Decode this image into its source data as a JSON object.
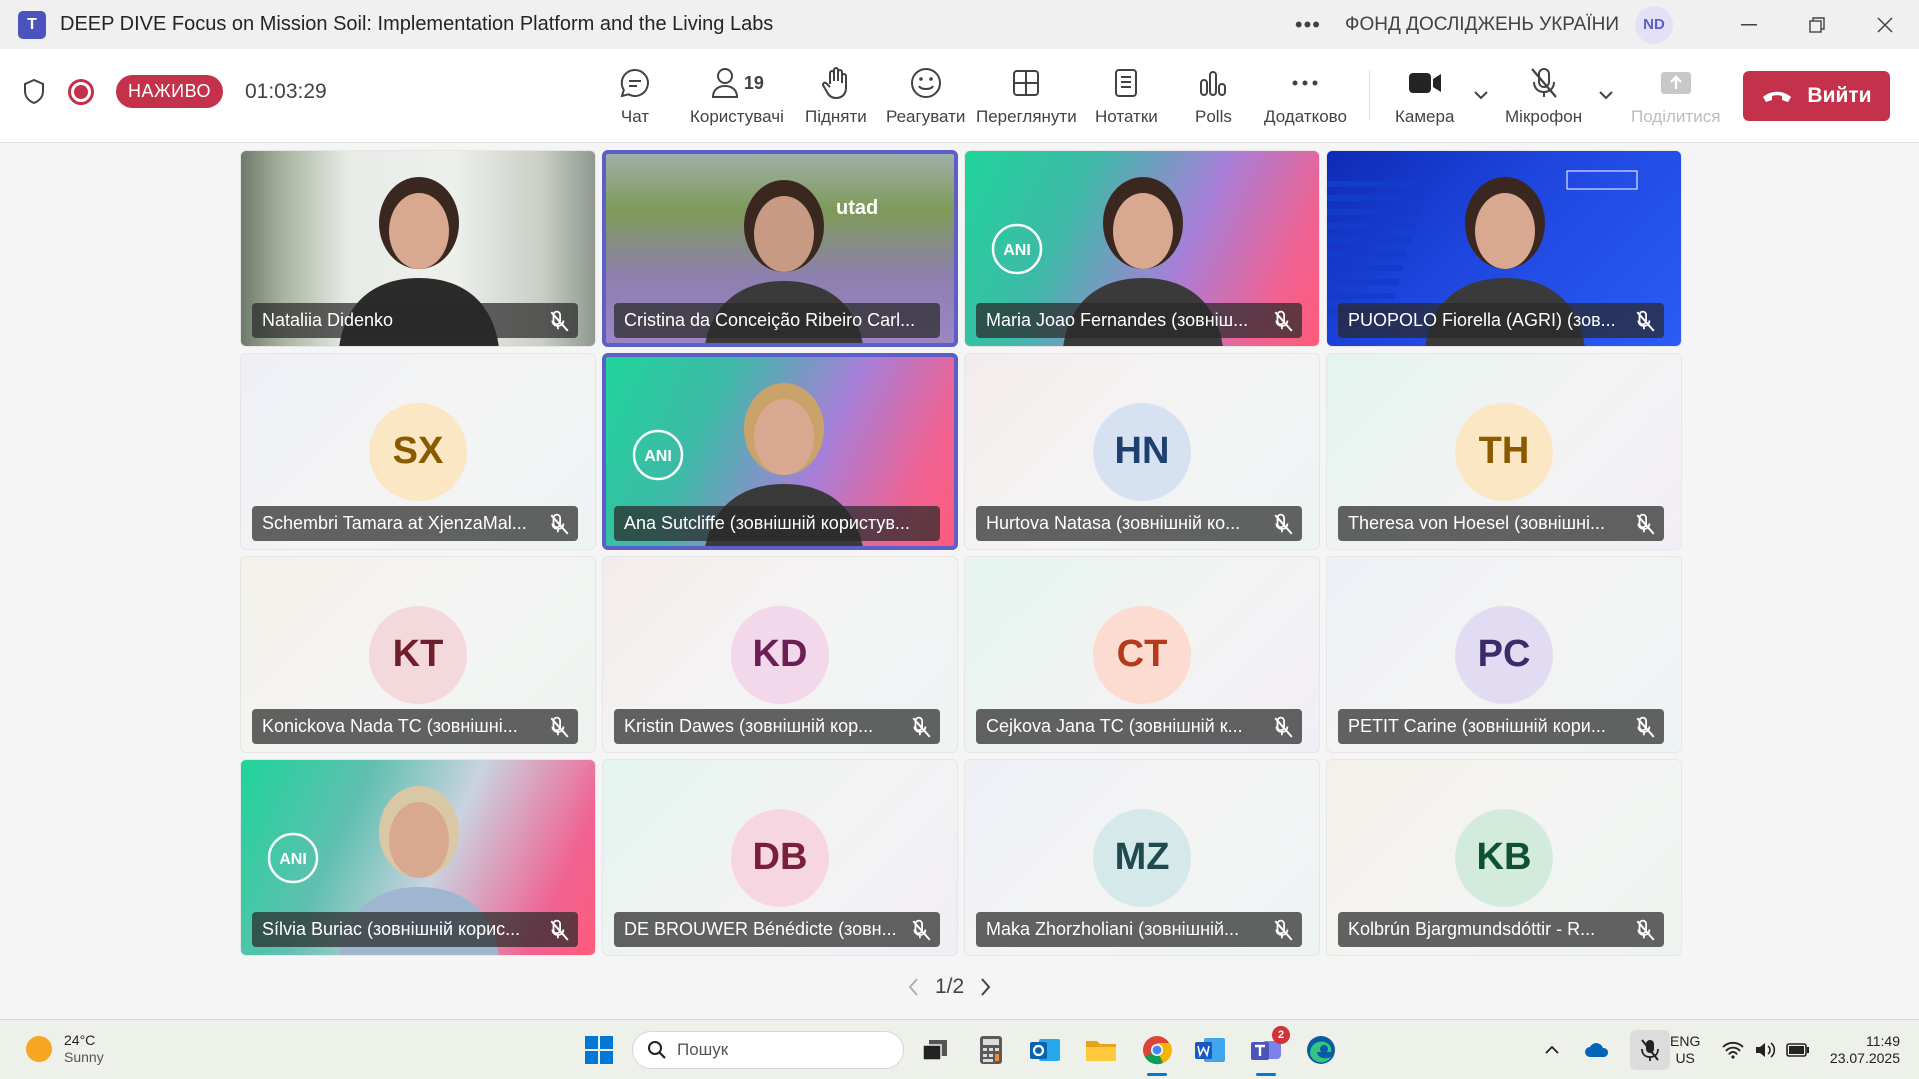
{
  "window": {
    "title": "DEEP DIVE Focus on Mission Soil: Implementation Platform and the Living Labs",
    "org": "ФОНД ДОСЛІДЖЕНЬ УКРАЇНИ",
    "user_initials": "ND"
  },
  "meeting": {
    "live_label": "НАЖИВО",
    "elapsed": "01:03:29",
    "people_count": "19",
    "toolbar": {
      "chat": "Чат",
      "people": "Користувачі",
      "raise": "Підняти",
      "react": "Реагувати",
      "view": "Переглянути",
      "notes": "Нотатки",
      "polls": "Polls",
      "more": "Додатково",
      "camera": "Камера",
      "mic": "Мікрофон",
      "share": "Поділитися",
      "leave": "Вийти"
    }
  },
  "participants": [
    {
      "name": "Nataliia Didenko",
      "initials": "",
      "video": "room"
    },
    {
      "name": "Cristina da Conceição Ribeiro Carl...",
      "initials": "",
      "video": "vineyard",
      "speaking": true
    },
    {
      "name": "Maria Joao Fernandes (зовніш...",
      "initials": "",
      "video": "ani"
    },
    {
      "name": "PUOPOLO Fiorella (AGRI) (зов...",
      "initials": "",
      "video": "ec"
    },
    {
      "name": "Schembri Tamara at XjenzaMal...",
      "initials": "SX",
      "color": "#8a5a00",
      "avbg": "#fbe7c4"
    },
    {
      "name": "Ana Sutcliffe (зовнішній користув...",
      "initials": "",
      "video": "ani2",
      "speaking": true
    },
    {
      "name": "Hurtova Natasa (зовнішній ко...",
      "initials": "HN",
      "color": "#1f3f6e",
      "avbg": "#d6e2f2"
    },
    {
      "name": "Theresa von Hoesel (зовнішні...",
      "initials": "TH",
      "color": "#8a5a00",
      "avbg": "#fbe7c4"
    },
    {
      "name": "Konickova Nada TC (зовнішні...",
      "initials": "KT",
      "color": "#6e1f2b",
      "avbg": "#f4d9dc"
    },
    {
      "name": "Kristin Dawes (зовнішній кор...",
      "initials": "KD",
      "color": "#6b1f55",
      "avbg": "#f2d8ea"
    },
    {
      "name": "Cejkova Jana TC (зовнішній к...",
      "initials": "CT",
      "color": "#b33a1a",
      "avbg": "#fcdcd0"
    },
    {
      "name": "PETIT Carine (зовнішній кори...",
      "initials": "PC",
      "color": "#3d2a6b",
      "avbg": "#e2dcf2"
    },
    {
      "name": "Sílvia Buriac (зовнішній корис...",
      "initials": "",
      "video": "ani3"
    },
    {
      "name": "DE BROUWER Bénédicte (зовн...",
      "initials": "DB",
      "color": "#7a1f3a",
      "avbg": "#f6d7e1"
    },
    {
      "name": "Maka Zhorzholiani (зовнішній...",
      "initials": "MZ",
      "color": "#1f4a4f",
      "avbg": "#d5e8ea"
    },
    {
      "name": "Kolbrún Bjargmundsdóttir - R...",
      "initials": "KB",
      "color": "#0f5132",
      "avbg": "#d3ebdd"
    }
  ],
  "pager": "1/2",
  "taskbar": {
    "weather_temp": "24°C",
    "weather_desc": "Sunny",
    "search_placeholder": "Пошук",
    "lang1": "ENG",
    "lang2": "US",
    "time": "11:49",
    "date": "23.07.2025",
    "teams_badge": "2"
  }
}
